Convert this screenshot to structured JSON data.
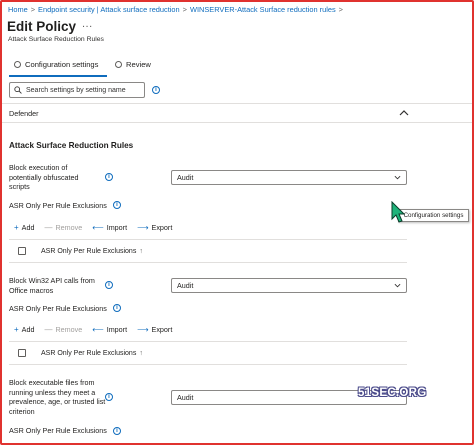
{
  "breadcrumb": [
    "Home",
    "Endpoint security | Attack surface reduction",
    "WINSERVER-Attack Surface reduction rules"
  ],
  "breadcrumb_sep": ">",
  "page": {
    "title": "Edit Policy",
    "more": "...",
    "subtitle": "Attack Surface Reduction Rules"
  },
  "tabs": [
    {
      "label": "Configuration settings",
      "selected": true
    },
    {
      "label": "Review",
      "selected": false
    }
  ],
  "search": {
    "placeholder": "Search settings by setting name"
  },
  "category": {
    "label": "Defender",
    "expanded": true
  },
  "section_title": "Attack Surface Reduction Rules",
  "rules": [
    {
      "label": "Block execution of potentially obfuscated scripts",
      "value": "Audit",
      "exclusions_label": "ASR Only Per Rule Exclusions",
      "toolbar": {
        "add": "Add",
        "remove": "Remove",
        "import": "Import",
        "export": "Export"
      },
      "table_header": "ASR Only Per Rule Exclusions"
    },
    {
      "label": "Block Win32 API calls from Office macros",
      "value": "Audit",
      "exclusions_label": "ASR Only Per Rule Exclusions",
      "toolbar": {
        "add": "Add",
        "remove": "Remove",
        "import": "Import",
        "export": "Export"
      },
      "table_header": "ASR Only Per Rule Exclusions"
    },
    {
      "label": "Block executable files from running unless they meet a prevalence, age, or trusted list criterion",
      "value": "Audit",
      "exclusions_label": "ASR Only Per Rule Exclusions"
    }
  ],
  "tooltip": "Configuration settings",
  "watermark": "51SEC.ORG",
  "colors": {
    "accent": "#0f6cbd",
    "frame_border": "#e0322f",
    "text": "#201f1e"
  }
}
